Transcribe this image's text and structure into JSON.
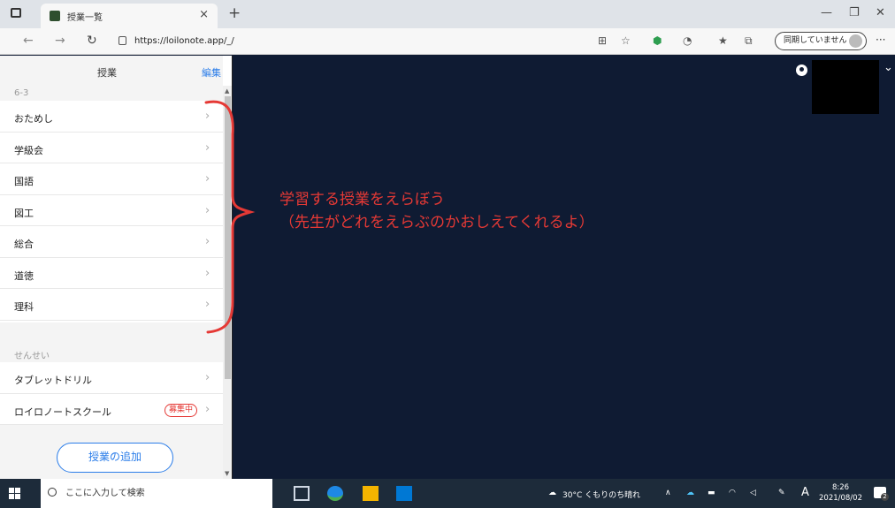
{
  "browser": {
    "tab_title": "授業一覧",
    "url": "https://loilonote.app/_/",
    "sync_label": "同期していません",
    "new_tab": "+",
    "close": "×",
    "more": "···"
  },
  "panel": {
    "title": "授業",
    "edit": "編集",
    "section1": "6-3",
    "classes": [
      {
        "label": "おためし"
      },
      {
        "label": "学級会"
      },
      {
        "label": "国語"
      },
      {
        "label": "図工"
      },
      {
        "label": "総合"
      },
      {
        "label": "道徳"
      },
      {
        "label": "理科"
      }
    ],
    "section2": "せんせい",
    "teacher_items": [
      {
        "label": "タブレットドリル"
      },
      {
        "label": "ロイロノートスクール",
        "badge": "募集中"
      }
    ],
    "add_button": "授業の追加"
  },
  "annotation": {
    "line1": "学習する授業をえらぼう",
    "line2": "（先生がどれをえらぶのかおしえてくれるよ）",
    "color": "#e53935"
  },
  "taskbar": {
    "search_placeholder": "ここに入力して検索",
    "weather": "30°C くもりのち晴れ",
    "ime": "A",
    "time": "8:26",
    "date": "2021/08/02",
    "notif_count": "2"
  },
  "colors": {
    "main_bg": "#0f1b33",
    "accent": "#2b7de9",
    "annotation": "#e53935"
  }
}
